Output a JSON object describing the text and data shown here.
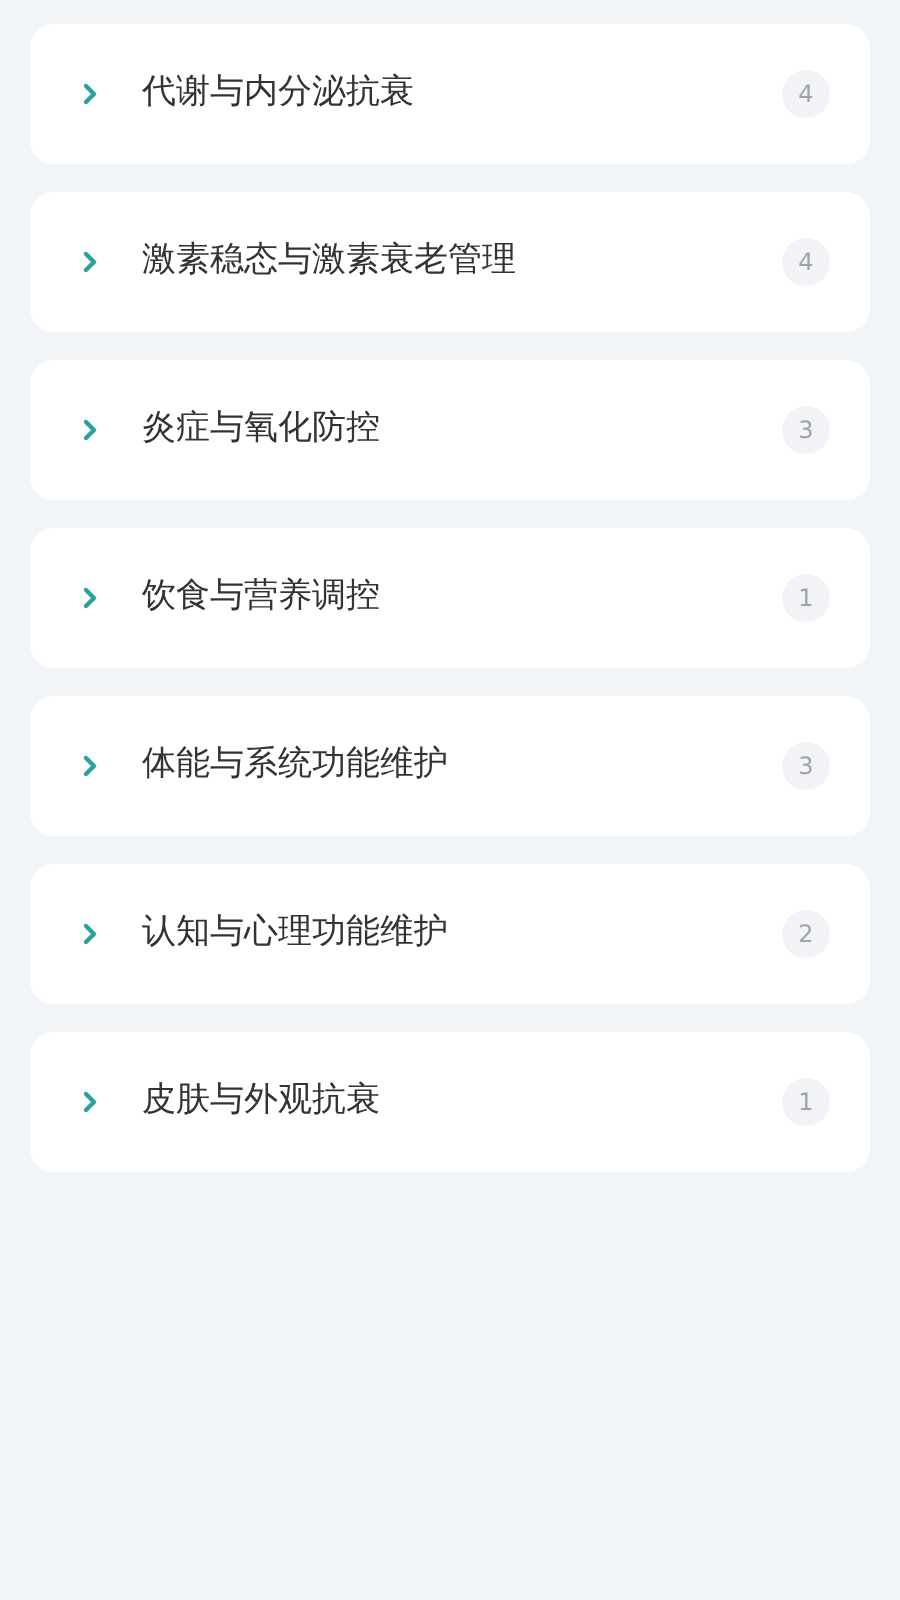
{
  "categories": [
    {
      "title": "代谢与内分泌抗衰",
      "count": "4",
      "expanded": false
    },
    {
      "title": "激素稳态与激素衰老管理",
      "count": "4",
      "expanded": false
    },
    {
      "title": "炎症与氧化防控",
      "count": "3",
      "expanded": false
    },
    {
      "title": "饮食与营养调控",
      "count": "1",
      "expanded": false
    },
    {
      "title": "体能与系统功能维护",
      "count": "3",
      "expanded": false
    },
    {
      "title": "认知与心理功能维护",
      "count": "2",
      "expanded": false
    },
    {
      "title": "皮肤与外观抗衰",
      "count": "1",
      "expanded": false
    }
  ]
}
